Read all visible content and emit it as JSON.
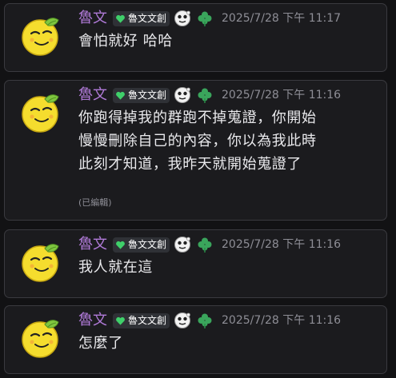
{
  "colors": {
    "username": "#b07ad8",
    "card_background": "#1b1b1e",
    "card_border": "#3a3a3f",
    "timestamp": "#8e8e96",
    "tag_background": "#2f3136",
    "heart_icon": "#3fcf6a",
    "avatar_fill": "#f5dd2e"
  },
  "messages": [
    {
      "username": "魯文",
      "tag": "魯文文創",
      "timestamp": "2025/7/28 下午 11:17",
      "lines": [
        "會怕就好 哈哈"
      ]
    },
    {
      "username": "魯文",
      "tag": "魯文文創",
      "timestamp": "2025/7/28 下午 11:16",
      "lines": [
        "你跑得掉我的群跑不掉蒐證，你開始",
        "慢慢刪除自己的內容，你以為我此時",
        "此刻才知道，我昨天就開始蒐證了"
      ],
      "edited": "(已編輯)"
    },
    {
      "username": "魯文",
      "tag": "魯文文創",
      "timestamp": "2025/7/28 下午 11:16",
      "lines": [
        "我人就在這"
      ]
    },
    {
      "username": "魯文",
      "tag": "魯文文創",
      "timestamp": "2025/7/28 下午 11:16",
      "lines": [
        "怎麼了"
      ]
    }
  ]
}
